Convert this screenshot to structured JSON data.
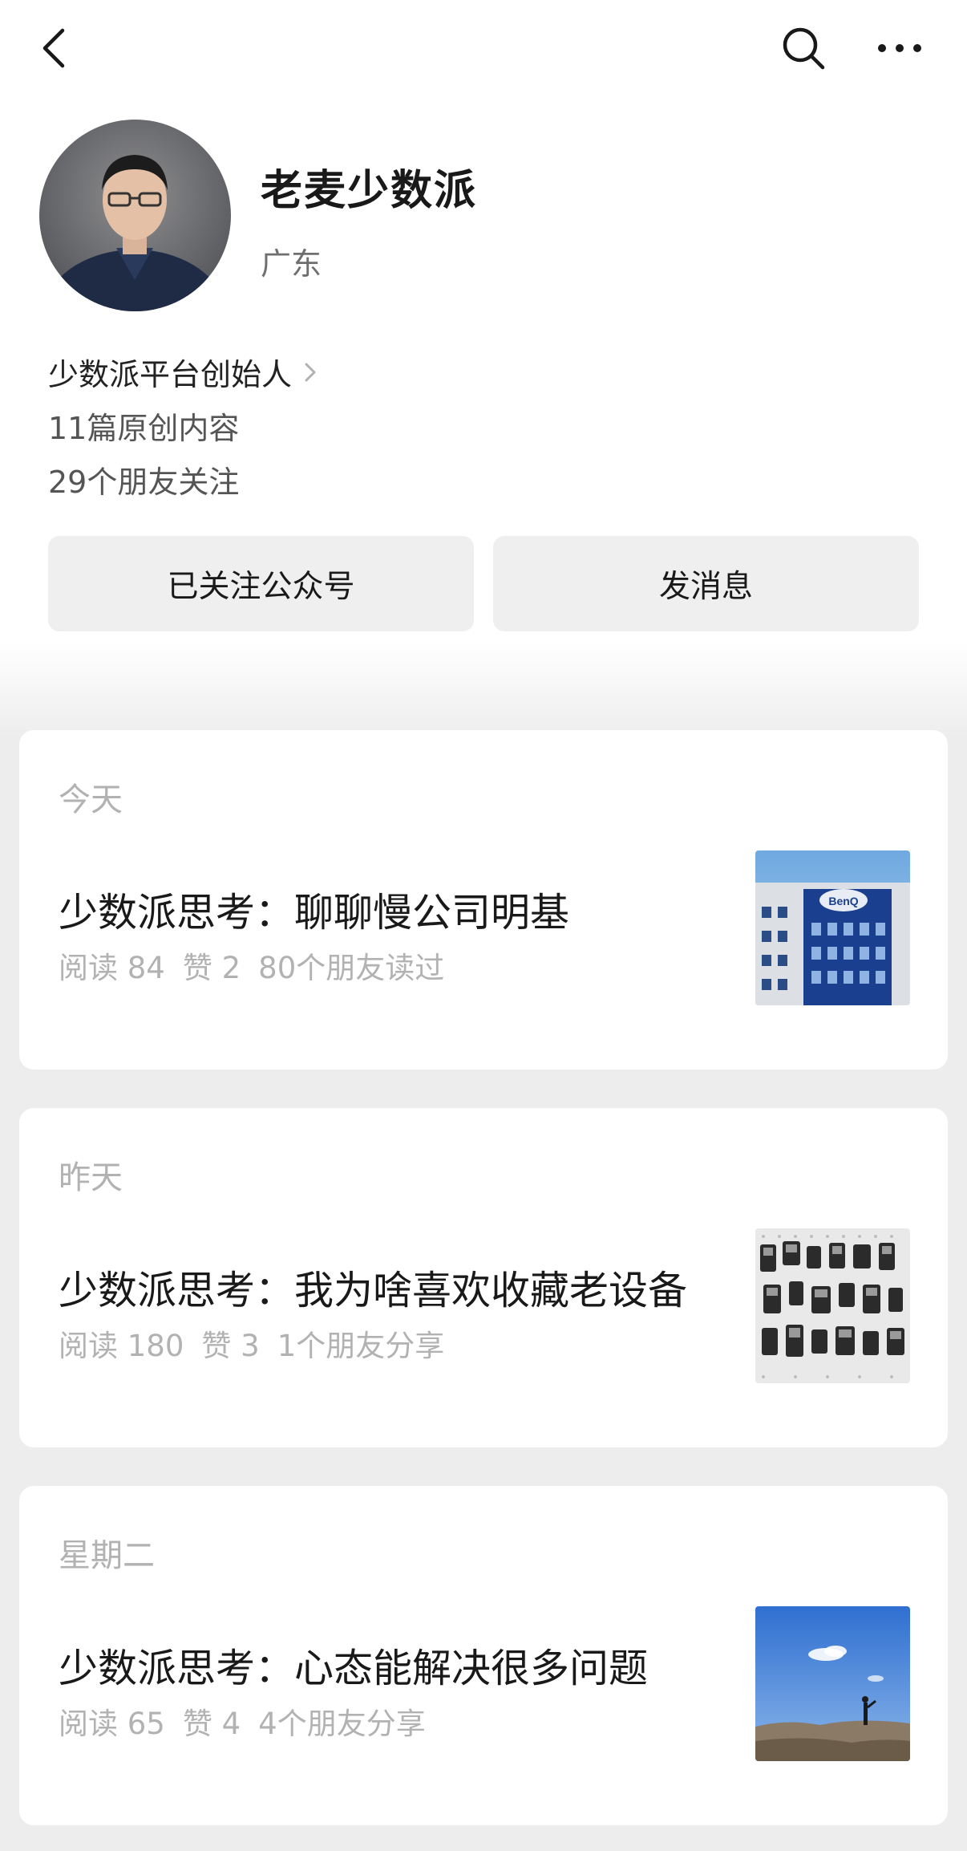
{
  "account": {
    "name": "老麦少数派",
    "region": "广东",
    "intro": "少数派平台创始人",
    "original_count": "11篇原创内容",
    "friends_following": "29个朋友关注"
  },
  "actions": {
    "follow_label": "已关注公众号",
    "message_label": "发消息"
  },
  "icons": {
    "back": "back-icon",
    "search": "search-icon",
    "more": "more-icon",
    "chevron": "chevron-right-icon"
  },
  "feed": [
    {
      "date": "今天",
      "title": "少数派思考：聊聊慢公司明基",
      "reads": "阅读 84",
      "likes": "赞 2",
      "social": "80个朋友读过",
      "thumb_text": "BenQ"
    },
    {
      "date": "昨天",
      "title": "少数派思考：我为啥喜欢收藏老设备",
      "reads": "阅读 180",
      "likes": "赞 3",
      "social": "1个朋友分享"
    },
    {
      "date": "星期二",
      "title": "少数派思考：心态能解决很多问题",
      "reads": "阅读 65",
      "likes": "赞 4",
      "social": "4个朋友分享"
    }
  ]
}
